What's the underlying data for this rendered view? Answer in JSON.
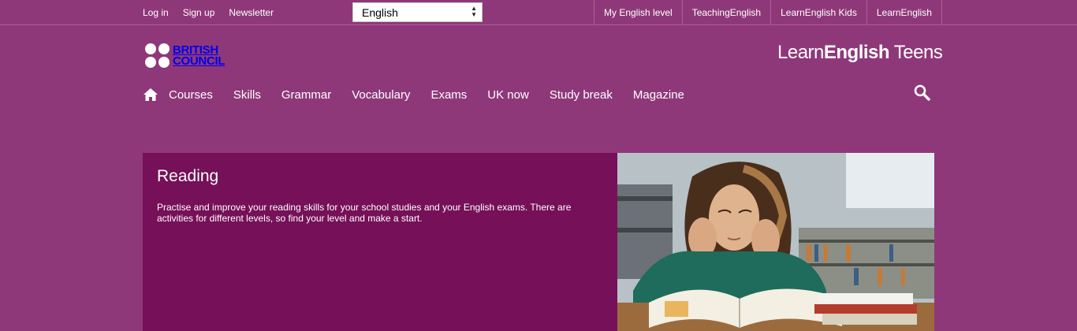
{
  "topbar": {
    "links": [
      "Log in",
      "Sign up",
      "Newsletter"
    ],
    "language": "English",
    "sites": [
      "My English level",
      "TeachingEnglish",
      "LearnEnglish Kids",
      "LearnEnglish"
    ]
  },
  "brand": {
    "bc_line1": "BRITISH",
    "bc_line2": "COUNCIL",
    "le_light": "Learn",
    "le_bold": "English",
    "le_tail": " Teens"
  },
  "nav": {
    "items": [
      "Courses",
      "Skills",
      "Grammar",
      "Vocabulary",
      "Exams",
      "UK now",
      "Study break",
      "Magazine"
    ]
  },
  "hero": {
    "title": "Reading",
    "description": "Practise and improve your reading skills for your school studies and your English exams. There are activities for different levels, so find your level and make a start."
  },
  "colors": {
    "background": "#8f3879",
    "hero_panel": "#761058"
  },
  "icons": [
    "home-icon",
    "search-icon",
    "select-arrow-icon"
  ]
}
